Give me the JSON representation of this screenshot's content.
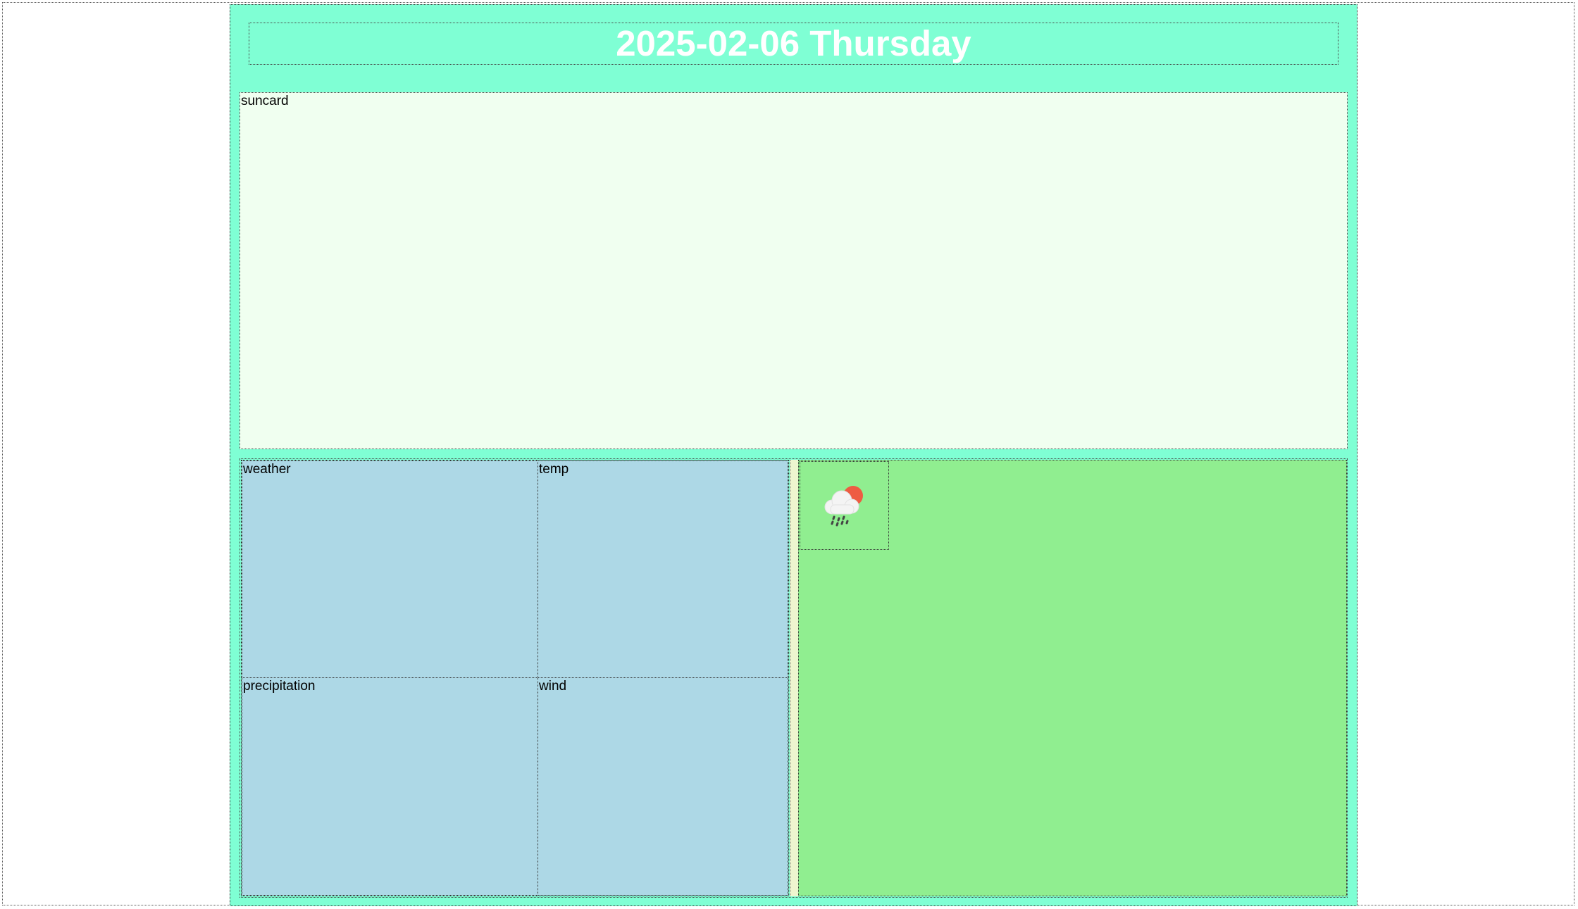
{
  "header": {
    "title": "2025-02-06 Thursday"
  },
  "suncard": {
    "label": "suncard"
  },
  "cards": {
    "weather": "weather",
    "temp": "temp",
    "precipitation": "precipitation",
    "wind": "wind"
  },
  "forecast": {
    "icon": "cloud-sun-rain-icon"
  },
  "colors": {
    "dashboard_bg": "#7fffd4",
    "suncard_bg": "#f0fff0",
    "card_bg": "#add8e6",
    "right_panel_bg": "#90ee90",
    "sun": "#ee5c43"
  }
}
